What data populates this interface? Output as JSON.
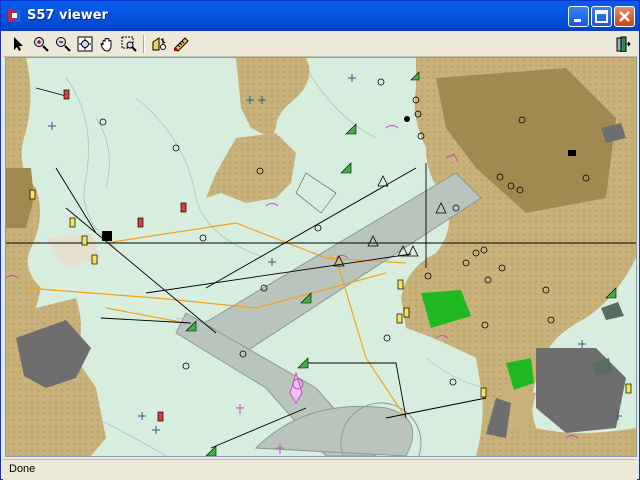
{
  "window": {
    "title": "S57 viewer"
  },
  "toolbar": {
    "left_tools": [
      "select-arrow-icon",
      "zoom-in-icon",
      "zoom-out-icon",
      "zoom-extents-icon",
      "pan-hand-icon",
      "zoom-window-icon",
      "query-object-icon",
      "measure-ruler-icon"
    ],
    "right_tools": [
      "exit-icon"
    ]
  },
  "status": {
    "text": "Done"
  },
  "colors": {
    "water": "#d7eedf",
    "land": "#c9b27a",
    "land_dark": "#a08a50",
    "runway": "#b9c4bd",
    "building": "#6e6e6e",
    "green": "#1fb81f",
    "depth_contour": "#9fbcae",
    "route_orange": "#f2a21b"
  }
}
